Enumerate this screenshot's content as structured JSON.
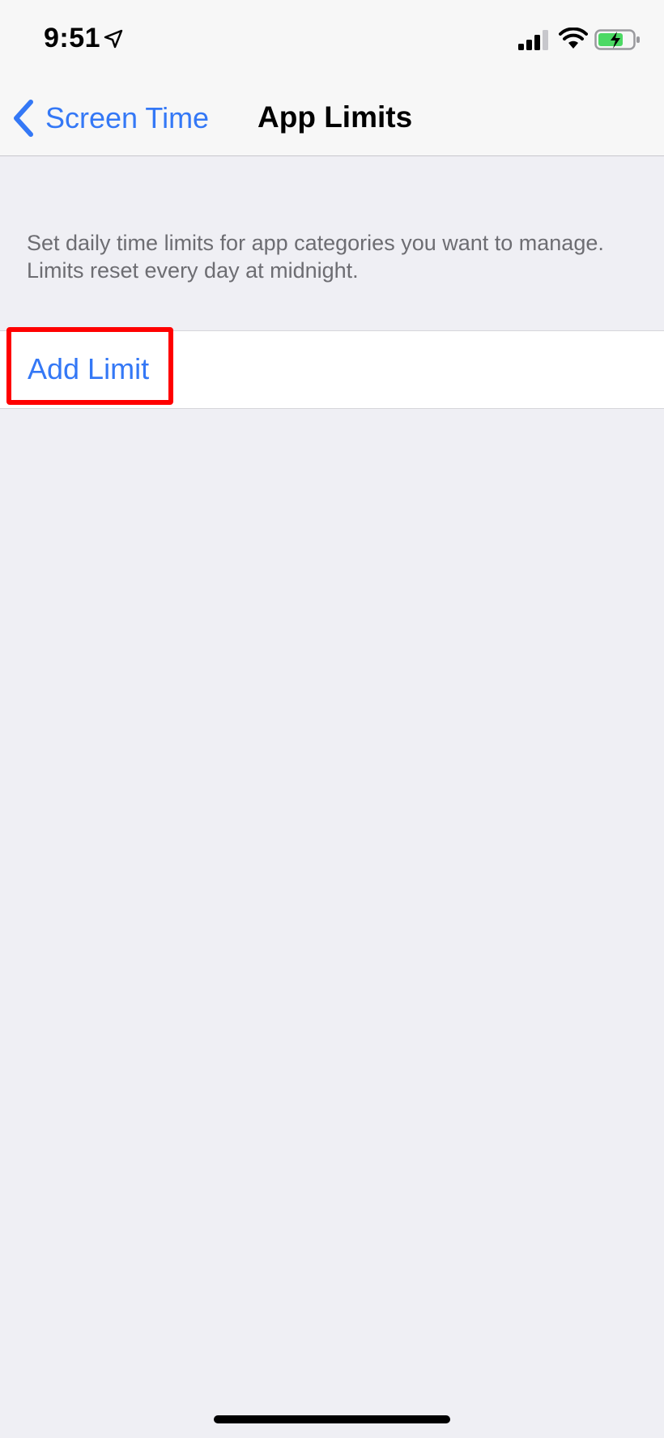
{
  "status_bar": {
    "time": "9:51",
    "location_icon": "location-arrow-icon",
    "signal_icon": "cellular-signal-icon",
    "wifi_icon": "wifi-icon",
    "battery_icon": "battery-charging-icon"
  },
  "nav": {
    "back_label": "Screen Time",
    "back_icon": "chevron-left-icon",
    "title": "App Limits"
  },
  "content": {
    "description": "Set daily time limits for app categories you want to manage. Limits reset every day at midnight.",
    "add_limit_label": "Add Limit"
  },
  "colors": {
    "accent": "#3478f6",
    "background": "#efeff4",
    "highlight": "#ff0000",
    "battery_fill": "#4cd964"
  }
}
